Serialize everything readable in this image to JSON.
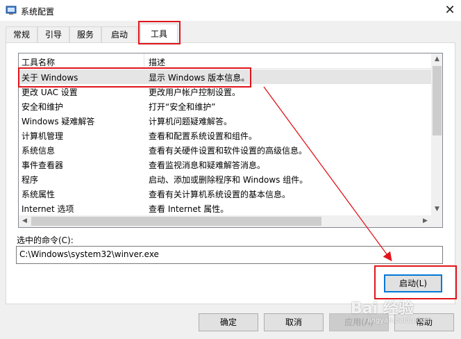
{
  "window": {
    "title": "系统配置",
    "close_glyph": "✕"
  },
  "tabs": [
    {
      "label": "常规"
    },
    {
      "label": "引导"
    },
    {
      "label": "服务"
    },
    {
      "label": "启动"
    },
    {
      "label": "工具",
      "active": true
    }
  ],
  "tool_list": {
    "columns": [
      "工具名称",
      "描述"
    ],
    "rows": [
      {
        "name": "关于 Windows",
        "desc": "显示 Windows 版本信息。",
        "selected": true
      },
      {
        "name": "更改 UAC 设置",
        "desc": "更改用户帐户控制设置。"
      },
      {
        "name": "安全和维护",
        "desc": "打开“安全和维护”"
      },
      {
        "name": "Windows 疑难解答",
        "desc": "计算机问题疑难解答。"
      },
      {
        "name": "计算机管理",
        "desc": "查看和配置系统设置和组件。"
      },
      {
        "name": "系统信息",
        "desc": "查看有关硬件设置和软件设置的高级信息。"
      },
      {
        "name": "事件查看器",
        "desc": "查看监视消息和疑难解答消息。"
      },
      {
        "name": "程序",
        "desc": "启动、添加或删除程序和 Windows 组件。"
      },
      {
        "name": "系统属性",
        "desc": "查看有关计算机系统设置的基本信息。"
      },
      {
        "name": "Internet 选项",
        "desc": "查看 Internet 属性。"
      }
    ]
  },
  "command": {
    "label": "选中的命令(C):",
    "value": "C:\\Windows\\system32\\winver.exe"
  },
  "buttons": {
    "launch": "启动(L)",
    "ok": "确定",
    "cancel": "取消",
    "apply": "应用(A)",
    "help": "帮助"
  },
  "watermark": {
    "main": "Bai 经验",
    "sub": "jingyan.baidu.com"
  },
  "colors": {
    "annotation": "#e0141b",
    "accent": "#0078d7"
  },
  "icons": [
    "app-config-icon",
    "close-icon",
    "scroll-up-icon",
    "scroll-down-icon",
    "scroll-left-icon",
    "scroll-right-icon"
  ]
}
